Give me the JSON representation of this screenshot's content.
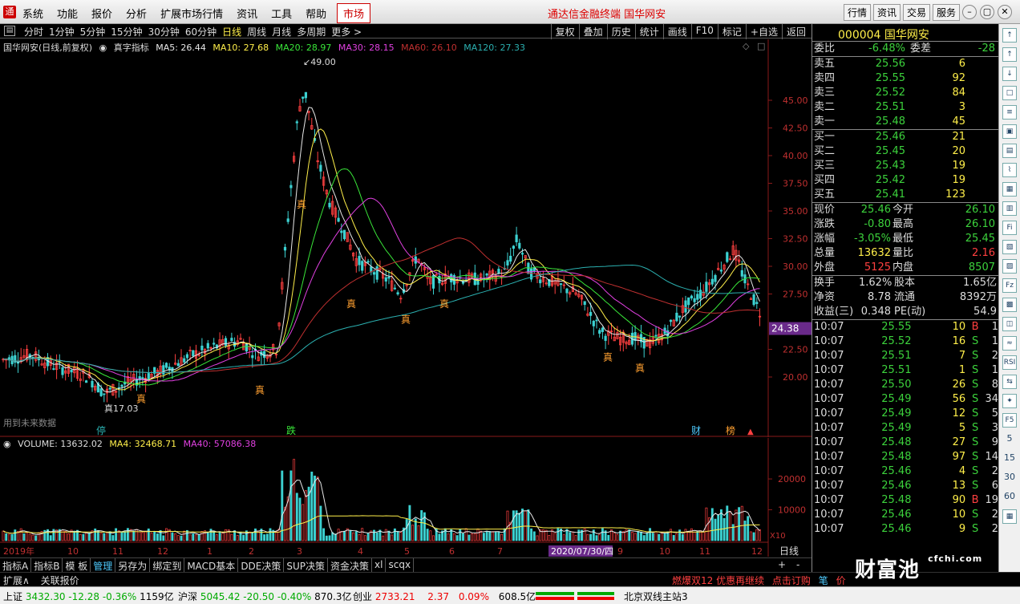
{
  "menubar": {
    "items": [
      "系统",
      "功能",
      "报价",
      "分析",
      "扩展市场行情",
      "资讯",
      "工具",
      "帮助"
    ],
    "market_label": "市场",
    "title": "通达信金融终端  国华网安",
    "right_buttons": [
      "行情",
      "资讯",
      "交易",
      "服务"
    ]
  },
  "periodbar": {
    "periods": [
      "分时",
      "1分钟",
      "5分钟",
      "15分钟",
      "30分钟",
      "60分钟",
      "日线",
      "周线",
      "月线",
      "多周期",
      "更多 >"
    ],
    "active": "日线",
    "tools": [
      "复权",
      "叠加",
      "历史",
      "统计",
      "画线",
      "F10",
      "标记",
      "+自选",
      "返回"
    ]
  },
  "main_chart": {
    "stock_label": "国华网安(日线,前复权)",
    "indicator": "真字指标",
    "ma": [
      {
        "label": "MA5: 26.44",
        "color": "#e8e8e8"
      },
      {
        "label": "MA10: 27.68",
        "color": "#ffef4a"
      },
      {
        "label": "MA20: 28.97",
        "color": "#39e639"
      },
      {
        "label": "MA30: 28.15",
        "color": "#e040e0"
      },
      {
        "label": "MA60: 26.10",
        "color": "#c03030"
      },
      {
        "label": "MA120: 27.33",
        "color": "#2bb0b0"
      }
    ],
    "future_note": "用到未来数据",
    "high_label": "49.00",
    "low_label": "17.03",
    "current_price_tag": "24.38",
    "price_ticks": [
      "45.00",
      "42.50",
      "40.00",
      "37.50",
      "35.00",
      "32.50",
      "30.00",
      "27.50",
      "22.50",
      "20.00"
    ],
    "zhen_marker": "真",
    "bottom_markers": {
      "ting": "停",
      "die": "跌",
      "cai": "财",
      "bang": "榜",
      "arrow": "▲"
    },
    "month_labels": [
      "2019年",
      "10",
      "11",
      "12",
      "1",
      "2",
      "3",
      "4",
      "5",
      "6",
      "7",
      "9",
      "10",
      "11",
      "12"
    ],
    "date_highlight": "2020/07/30/四",
    "period_tag": "日线"
  },
  "volume_chart": {
    "label": "VOLUME: 13632.02",
    "ma4": "MA4: 32468.71",
    "ma40": "MA40: 57086.38",
    "ticks": [
      "20000",
      "10000"
    ],
    "unit": "X10"
  },
  "tabbar": {
    "tabs": [
      "指标A",
      "指标B",
      "模 板",
      "管理",
      "另存为",
      "绑定到",
      "MACD基本",
      "DDE决策",
      "SUP决策",
      "资金决策",
      "xl",
      "scqx"
    ],
    "active": "管理",
    "controls": [
      "+",
      "-"
    ]
  },
  "extbar": {
    "left": [
      "扩展∧",
      "关联报价"
    ],
    "right": [
      "燃爆双12 优惠再继续",
      "点击订购",
      "笔",
      "价"
    ]
  },
  "statusbar": {
    "sh": {
      "name": "上证",
      "price": "3432.30",
      "chg": "-12.28",
      "pct": "-0.36%",
      "amt": "1159亿"
    },
    "sz": {
      "name": "沪深",
      "price": "5045.42",
      "chg": "-20.50",
      "pct": "-0.40%",
      "amt": "870.3亿"
    },
    "cy": {
      "name": "创业",
      "price": "2733.21",
      "chg": "2.37",
      "pct": "0.09%",
      "amt": "608.5亿"
    },
    "server": "北京双线主站3"
  },
  "quote": {
    "code": "000004",
    "name": "国华网安",
    "weibi_label": "委比",
    "weibi": "-6.48%",
    "weicha_label": "委差",
    "weicha": "-28",
    "sells": [
      {
        "label": "卖五",
        "price": "25.56",
        "vol": "6"
      },
      {
        "label": "卖四",
        "price": "25.55",
        "vol": "92"
      },
      {
        "label": "卖三",
        "price": "25.52",
        "vol": "84"
      },
      {
        "label": "卖二",
        "price": "25.51",
        "vol": "3"
      },
      {
        "label": "卖一",
        "price": "25.48",
        "vol": "45"
      }
    ],
    "buys": [
      {
        "label": "买一",
        "price": "25.46",
        "vol": "21"
      },
      {
        "label": "买二",
        "price": "25.45",
        "vol": "20"
      },
      {
        "label": "买三",
        "price": "25.43",
        "vol": "19"
      },
      {
        "label": "买四",
        "price": "25.42",
        "vol": "19"
      },
      {
        "label": "买五",
        "price": "25.41",
        "vol": "123"
      }
    ],
    "stats": [
      {
        "l1": "现价",
        "v1": "25.46",
        "c1": "g",
        "l2": "今开",
        "v2": "26.10",
        "c2": "g"
      },
      {
        "l1": "涨跌",
        "v1": "-0.80",
        "c1": "g",
        "l2": "最高",
        "v2": "26.10",
        "c2": "g"
      },
      {
        "l1": "涨幅",
        "v1": "-3.05%",
        "c1": "g",
        "l2": "最低",
        "v2": "25.45",
        "c2": "g"
      },
      {
        "l1": "总量",
        "v1": "13632",
        "c1": "y",
        "l2": "量比",
        "v2": "2.16",
        "c2": "r"
      },
      {
        "l1": "外盘",
        "v1": "5125",
        "c1": "r",
        "l2": "内盘",
        "v2": "8507",
        "c2": "g"
      }
    ],
    "stats2": [
      {
        "l1": "换手",
        "v1": "1.62%",
        "l2": "股本",
        "v2": "1.65亿"
      },
      {
        "l1": "净资",
        "v1": "8.78",
        "l2": "流通",
        "v2": "8392万"
      },
      {
        "l1": "收益(三)",
        "v1": "0.348",
        "l2": "PE(动)",
        "v2": "54.9"
      }
    ],
    "ticks": [
      {
        "t": "10:07",
        "p": "25.55",
        "v": "10",
        "bs": "B",
        "n": "1"
      },
      {
        "t": "10:07",
        "p": "25.52",
        "v": "16",
        "bs": "S",
        "n": "1"
      },
      {
        "t": "10:07",
        "p": "25.51",
        "v": "7",
        "bs": "S",
        "n": "2"
      },
      {
        "t": "10:07",
        "p": "25.51",
        "v": "1",
        "bs": "S",
        "n": "1"
      },
      {
        "t": "10:07",
        "p": "25.50",
        "v": "26",
        "bs": "S",
        "n": "8"
      },
      {
        "t": "10:07",
        "p": "25.49",
        "v": "56",
        "bs": "S",
        "n": "34"
      },
      {
        "t": "10:07",
        "p": "25.49",
        "v": "12",
        "bs": "S",
        "n": "5"
      },
      {
        "t": "10:07",
        "p": "25.49",
        "v": "5",
        "bs": "S",
        "n": "3"
      },
      {
        "t": "10:07",
        "p": "25.48",
        "v": "27",
        "bs": "S",
        "n": "9"
      },
      {
        "t": "10:07",
        "p": "25.48",
        "v": "97",
        "bs": "S",
        "n": "14"
      },
      {
        "t": "10:07",
        "p": "25.46",
        "v": "4",
        "bs": "S",
        "n": "2"
      },
      {
        "t": "10:07",
        "p": "25.46",
        "v": "13",
        "bs": "S",
        "n": "6"
      },
      {
        "t": "10:07",
        "p": "25.48",
        "v": "90",
        "bs": "B",
        "n": "19"
      },
      {
        "t": "10:07",
        "p": "25.46",
        "v": "10",
        "bs": "S",
        "n": "2"
      },
      {
        "t": "10:07",
        "p": "25.46",
        "v": "9",
        "bs": "S",
        "n": "2"
      }
    ]
  },
  "iconstrip": [
    "↑",
    "↑",
    "↓",
    "□",
    "≡",
    "▣",
    "▤",
    "⌇",
    "▦",
    "▥",
    "Fi",
    "▧",
    "▨",
    "Fz",
    "▩",
    "◫",
    "≈",
    "RSI",
    "⇆",
    "✦",
    "F5",
    "5",
    "15",
    "30",
    "60",
    "▦"
  ],
  "watermark": "财富池",
  "watermark_site": "cfchi.com"
}
